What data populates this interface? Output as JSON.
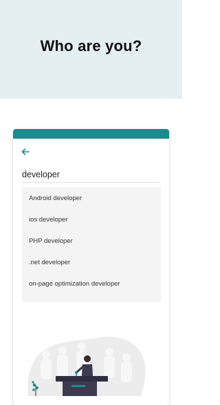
{
  "header": {
    "title": "Who are you?"
  },
  "search": {
    "value": "developer"
  },
  "suggestions": [
    "Android developer",
    "ios developer",
    "PHP developer",
    ".net developer",
    "on-page optimization developer"
  ],
  "colors": {
    "accent": "#1d8a8d",
    "header_bg": "#e4eff1"
  },
  "icons": {
    "back": "back-arrow-icon"
  }
}
